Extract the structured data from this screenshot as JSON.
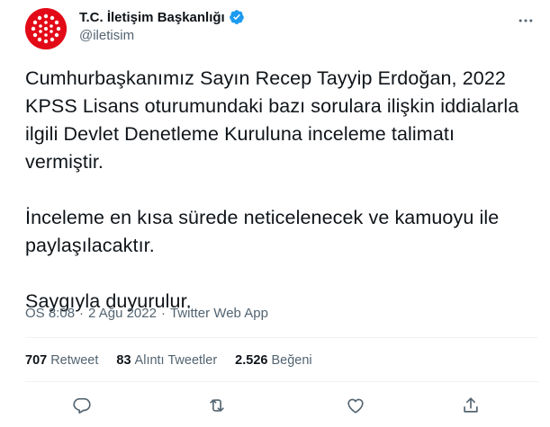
{
  "account": {
    "display_name": "T.C. İletişim Başkanlığı",
    "handle": "@iletisim",
    "verified": true,
    "avatar_color": "#e30a17",
    "verified_color": "#1d9bf0"
  },
  "tweet": {
    "text": "Cumhurbaşkanımız Sayın Recep Tayyip Erdoğan, 2022 KPSS Lisans oturumundaki bazı sorulara ilişkin iddialarla ilgili Devlet Denetleme Kuruluna inceleme talimatı vermiştir.\n\nİnceleme en kısa sürede neticelenecek ve kamuoyu ile paylaşılacaktır.\n\nSaygıyla duyurulur.",
    "time": "ÖS 8:08",
    "separator": "·",
    "date": "2 Ağu 2022",
    "source": "Twitter Web App"
  },
  "stats": {
    "retweets": {
      "count": "707",
      "label": "Retweet"
    },
    "quotes": {
      "count": "83",
      "label": "Alıntı Tweetler"
    },
    "likes": {
      "count": "2.526",
      "label": "Beğeni"
    }
  },
  "actions": [
    "reply-icon",
    "retweet-icon",
    "like-icon",
    "share-icon"
  ],
  "colors": {
    "text": "#0f1419",
    "secondary": "#536471",
    "divider": "#eff3f4"
  }
}
